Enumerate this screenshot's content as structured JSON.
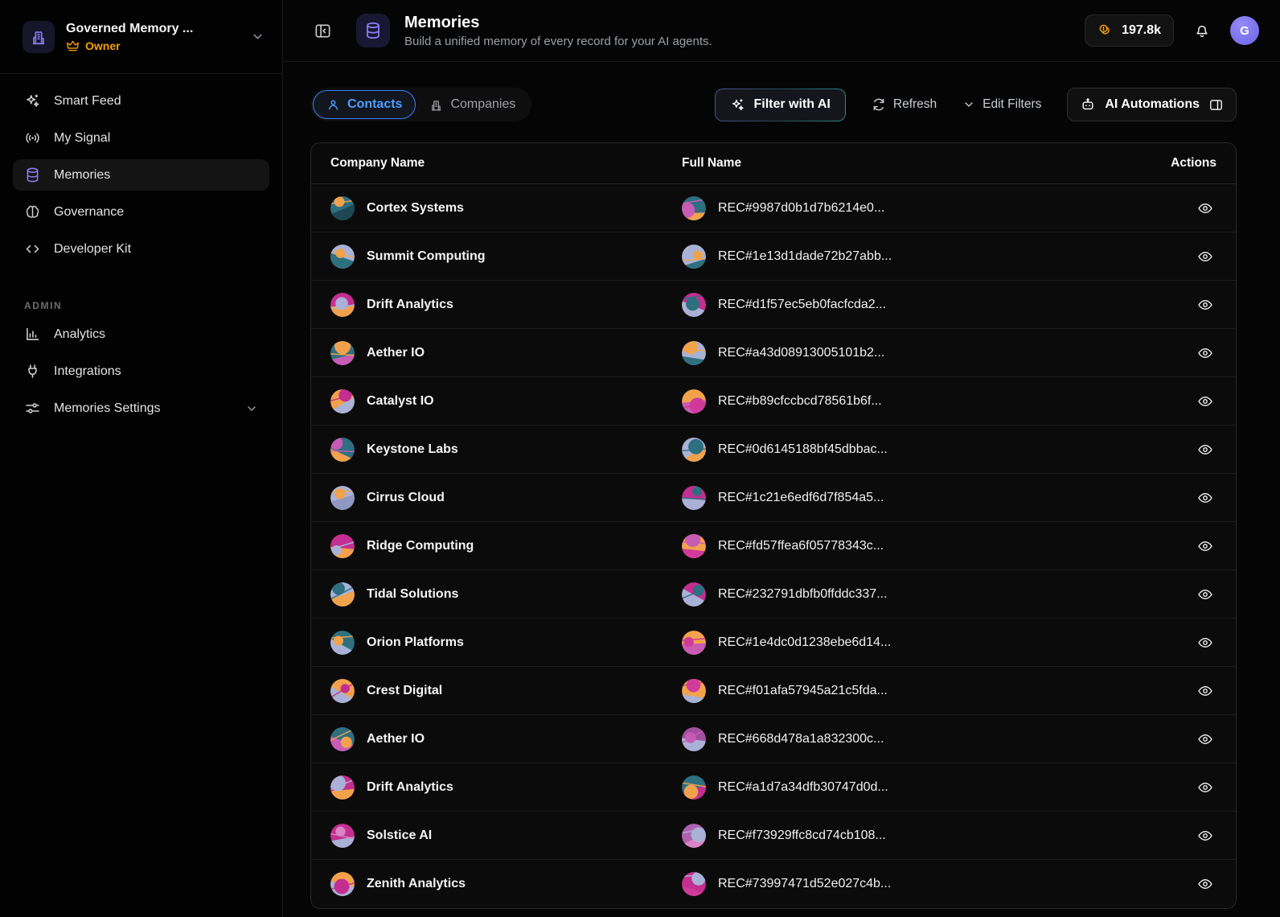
{
  "org": {
    "name": "Governed Memory ...",
    "role": "Owner"
  },
  "sidebar": {
    "items": [
      {
        "label": "Smart Feed"
      },
      {
        "label": "My Signal"
      },
      {
        "label": "Memories"
      },
      {
        "label": "Governance"
      },
      {
        "label": "Developer Kit"
      }
    ],
    "admin_label": "ADMIN",
    "admin_items": [
      {
        "label": "Analytics"
      },
      {
        "label": "Integrations"
      },
      {
        "label": "Memories Settings"
      }
    ]
  },
  "header": {
    "title": "Memories",
    "subtitle": "Build a unified memory of every record for your AI agents.",
    "credits": "197.8k",
    "avatar_initial": "G"
  },
  "toolbar": {
    "tabs": {
      "contacts": "Contacts",
      "companies": "Companies"
    },
    "filter_with_ai": "Filter with AI",
    "refresh": "Refresh",
    "edit_filters": "Edit Filters",
    "ai_automations": "AI Automations"
  },
  "table": {
    "columns": {
      "company": "Company Name",
      "full_name": "Full Name",
      "actions": "Actions"
    },
    "rows": [
      {
        "company": "Cortex Systems",
        "record": "REC#9987d0b1d7b6214e0...",
        "company_avatar": [
          "#2e6f80",
          "#f2a24c",
          "#1d4853"
        ],
        "contact_avatar": [
          "#2e6f80",
          "#c85cb5",
          "#f2a24c"
        ]
      },
      {
        "company": "Summit Computing",
        "record": "REC#1e13d1dade72b27abb...",
        "company_avatar": [
          "#a9b2d6",
          "#f2a24c",
          "#2e6f80"
        ],
        "contact_avatar": [
          "#a9b2d6",
          "#f2a24c",
          "#2e6f80"
        ]
      },
      {
        "company": "Drift Analytics",
        "record": "REC#d1f57ec5eb0facfcda2...",
        "company_avatar": [
          "#c42e90",
          "#a9b2d6",
          "#f2a24c"
        ],
        "contact_avatar": [
          "#c42e90",
          "#2e6f80",
          "#a9b2d6"
        ]
      },
      {
        "company": "Aether IO",
        "record": "REC#a43d08913005101b2...",
        "company_avatar": [
          "#2e6f80",
          "#f2a24c",
          "#c85cb5"
        ],
        "contact_avatar": [
          "#a9b2d6",
          "#f2a24c",
          "#2e6f80"
        ]
      },
      {
        "company": "Catalyst IO",
        "record": "REC#b89cfccbcd78561b6f...",
        "company_avatar": [
          "#f2a24c",
          "#c42e90",
          "#a9b2d6"
        ],
        "contact_avatar": [
          "#f2a24c",
          "#d03a9a",
          "#c85cb5"
        ]
      },
      {
        "company": "Keystone Labs",
        "record": "REC#0d6145188bf45dbbac...",
        "company_avatar": [
          "#2e6f80",
          "#c85cb5",
          "#f2a24c"
        ],
        "contact_avatar": [
          "#a9b2d6",
          "#2e6f80",
          "#f2a24c"
        ]
      },
      {
        "company": "Cirrus Cloud",
        "record": "REC#1c21e6edf6d7f854a5...",
        "company_avatar": [
          "#a9b2d6",
          "#f2a24c",
          "#8f98c0"
        ],
        "contact_avatar": [
          "#c42e90",
          "#2e6f80",
          "#a9b2d6"
        ]
      },
      {
        "company": "Ridge Computing",
        "record": "REC#fd57ffea6f05778343c...",
        "company_avatar": [
          "#c42e90",
          "#a9b2d6",
          "#f2a24c"
        ],
        "contact_avatar": [
          "#f2a24c",
          "#c85cb5",
          "#d03a9a"
        ]
      },
      {
        "company": "Tidal Solutions",
        "record": "REC#232791dbfb0ffddc337...",
        "company_avatar": [
          "#a9b2d6",
          "#2e6f80",
          "#f2a24c"
        ],
        "contact_avatar": [
          "#c42e90",
          "#2e6f80",
          "#a9b2d6"
        ]
      },
      {
        "company": "Orion Platforms",
        "record": "REC#1e4dc0d1238ebe6d14...",
        "company_avatar": [
          "#2e6f80",
          "#f2a24c",
          "#a9b2d6"
        ],
        "contact_avatar": [
          "#f2a24c",
          "#d03a9a",
          "#c85cb5"
        ]
      },
      {
        "company": "Crest Digital",
        "record": "REC#f01afa57945a21c5fda...",
        "company_avatar": [
          "#f2a24c",
          "#c42e90",
          "#a9b2d6"
        ],
        "contact_avatar": [
          "#f2a24c",
          "#d03a9a",
          "#a9b2d6"
        ]
      },
      {
        "company": "Aether IO",
        "record": "REC#668d478a1a832300c...",
        "company_avatar": [
          "#2e6f80",
          "#f2a24c",
          "#c85cb5"
        ],
        "contact_avatar": [
          "#a34fa0",
          "#c85cb5",
          "#a9b2d6"
        ]
      },
      {
        "company": "Drift Analytics",
        "record": "REC#a1d7a34dfb30747d0d...",
        "company_avatar": [
          "#c42e90",
          "#a9b2d6",
          "#f2a24c"
        ],
        "contact_avatar": [
          "#2e6f80",
          "#f2a24c",
          "#c42e90"
        ]
      },
      {
        "company": "Solstice AI",
        "record": "REC#f73929ffc8cd74cb108...",
        "company_avatar": [
          "#c42e90",
          "#d884c6",
          "#a9b2d6"
        ],
        "contact_avatar": [
          "#b061ae",
          "#a9b2d6",
          "#d884c6"
        ]
      },
      {
        "company": "Zenith Analytics",
        "record": "REC#73997471d52e027c4b...",
        "company_avatar": [
          "#f2a24c",
          "#c42e90",
          "#a9b2d6"
        ],
        "contact_avatar": [
          "#c42e90",
          "#a9b2d6",
          "#d03a9a"
        ]
      }
    ]
  },
  "colors": {
    "accent_purple": "#8b7cf6",
    "accent_blue": "#3b82f6",
    "accent_amber": "#f59e0b",
    "background": "#050505"
  }
}
